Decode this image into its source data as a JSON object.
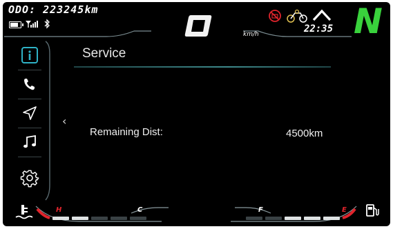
{
  "status_bar": {
    "odometer": "ODO: 223245km",
    "gear_display": "0",
    "speed_unit": "km/h",
    "clock": "22:35",
    "gear_position": "N",
    "colors": {
      "neutral": "#39d23c",
      "warning": "#e0242c",
      "temp_hot": "#e0242c"
    }
  },
  "sidebar": {
    "items": [
      {
        "name": "info-icon",
        "active": true
      },
      {
        "name": "phone-icon",
        "active": false
      },
      {
        "name": "navigation-icon",
        "active": false
      },
      {
        "name": "music-icon",
        "active": false
      },
      {
        "name": "settings-gear-icon",
        "active": false
      }
    ]
  },
  "main": {
    "title": "Service",
    "back_chevron": "‹",
    "rows": [
      {
        "label": "Remaining Dist:",
        "value": "4500km"
      }
    ]
  },
  "gauges": {
    "temp_hot_label": "H",
    "temp_cold_label": "C",
    "fuel_full_label": "F",
    "fuel_empty_label": "E"
  }
}
